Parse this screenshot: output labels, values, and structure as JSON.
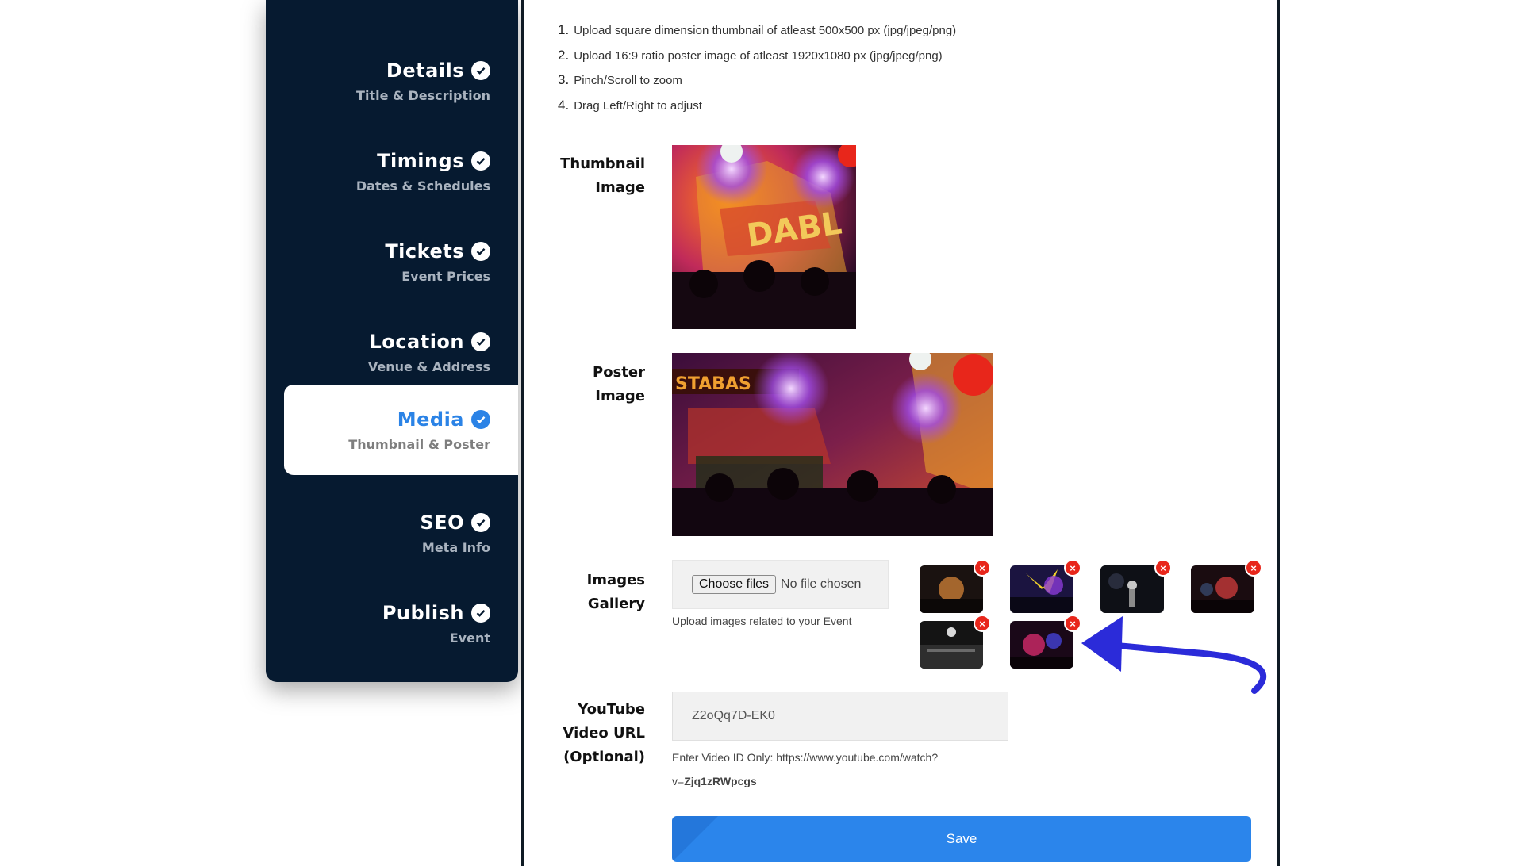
{
  "sidebar": {
    "items": [
      {
        "title": "Details",
        "subtitle": "Title & Description"
      },
      {
        "title": "Timings",
        "subtitle": "Dates & Schedules"
      },
      {
        "title": "Tickets",
        "subtitle": "Event Prices"
      },
      {
        "title": "Location",
        "subtitle": "Venue & Address"
      },
      {
        "title": "Media",
        "subtitle": "Thumbnail & Poster"
      },
      {
        "title": "SEO",
        "subtitle": "Meta Info"
      },
      {
        "title": "Publish",
        "subtitle": "Event"
      }
    ],
    "active_index": 4,
    "active_color": "#2b83e6",
    "background": "#061a30"
  },
  "instructions": [
    {
      "num": "1.",
      "text": "Upload square dimension thumbnail of atleast 500x500 px (jpg/jpeg/png)"
    },
    {
      "num": "2.",
      "text": "Upload 16:9 ratio poster image of atleast 1920x1080 px (jpg/jpeg/png)"
    },
    {
      "num": "3.",
      "text": "Pinch/Scroll to zoom"
    },
    {
      "num": "4.",
      "text": "Drag Left/Right to adjust"
    }
  ],
  "thumbnail": {
    "label_line1": "Thumbnail",
    "label_line2": "Image"
  },
  "poster": {
    "label_line1": "Poster",
    "label_line2": "Image",
    "overlay_text": "STABAS"
  },
  "gallery": {
    "label_line1": "Images",
    "label_line2": "Gallery",
    "choose_label": "Choose files",
    "no_file": "No file chosen",
    "help": "Upload images related to your Event",
    "remove_symbol": "×",
    "image_count": 6
  },
  "youtube": {
    "label_line1": "YouTube",
    "label_line2": "Video URL",
    "label_line3": "(Optional)",
    "value": "Z2oQq7D-EK0",
    "help_line1": "Enter Video ID Only: https://www.youtube.com/watch?",
    "help_prefix": "v=",
    "help_id": "Zjq1zRWpcgs"
  },
  "save_label": "Save",
  "colors": {
    "accent": "#2b85eb",
    "remove": "#e8261b",
    "arrow": "#2b2bd9"
  }
}
